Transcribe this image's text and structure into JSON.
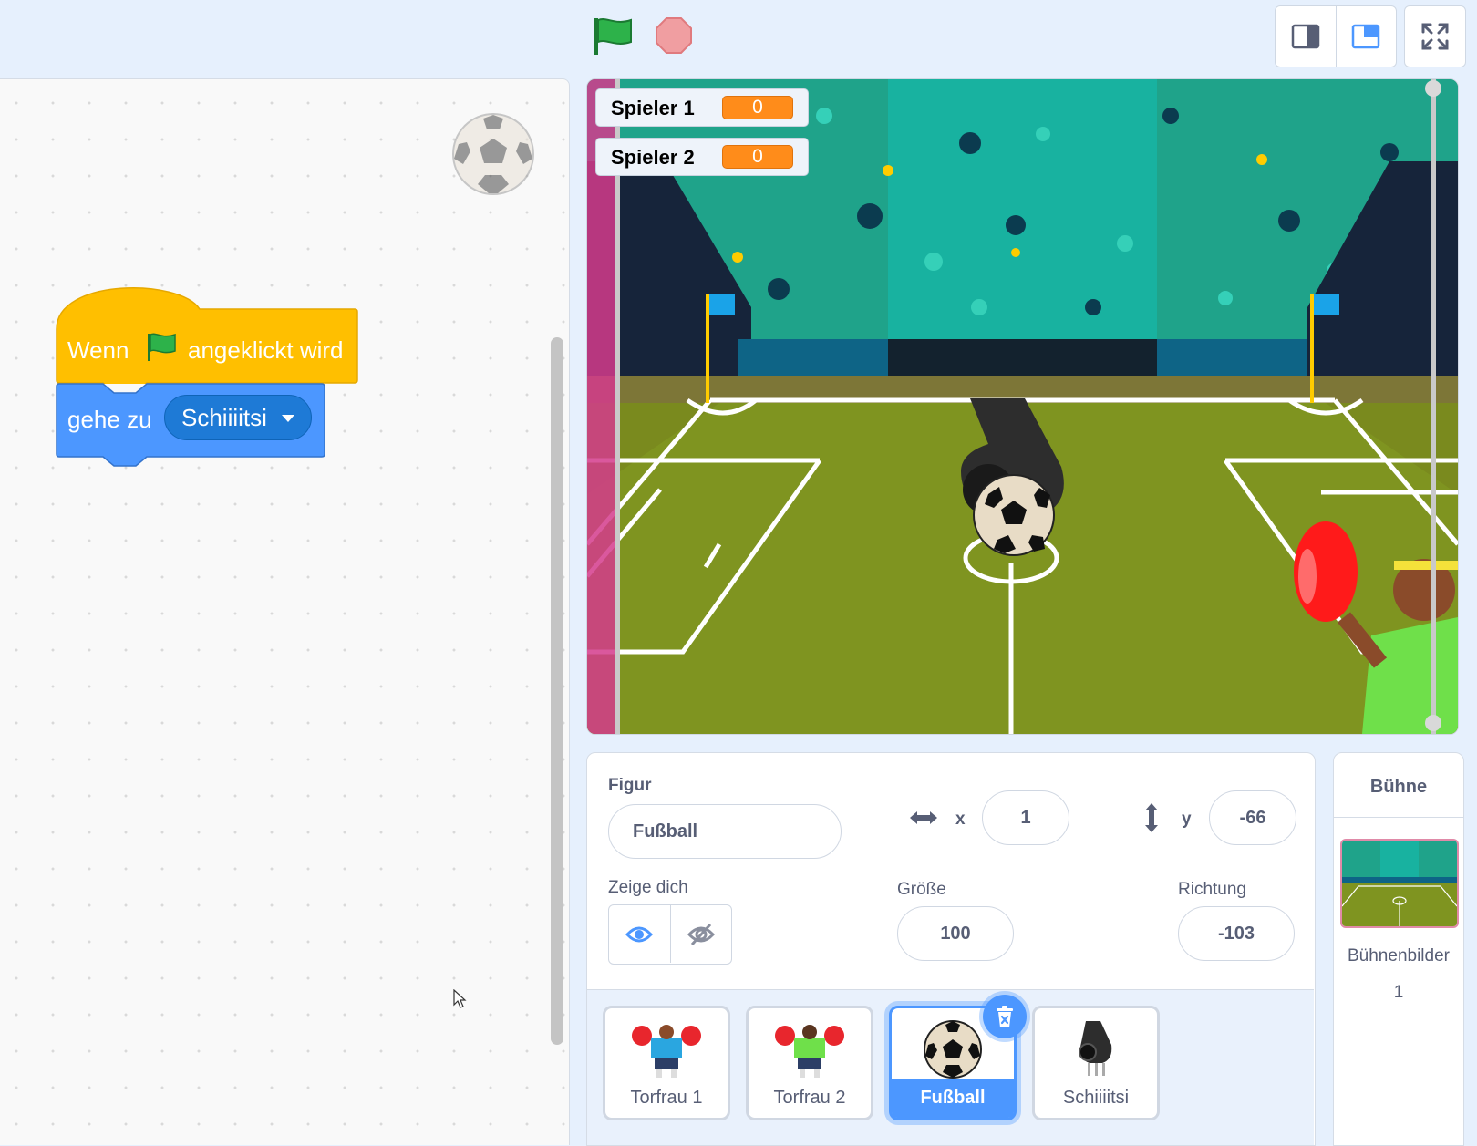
{
  "toolbar": {
    "green_flag_icon": "green-flag-icon",
    "stop_icon": "stop-sign-icon",
    "layout_small_icon": "small-stage-layout-icon",
    "layout_normal_icon": "normal-stage-layout-icon",
    "fullscreen_icon": "fullscreen-icon",
    "colors": {
      "flag": "#2db24a",
      "stop": "#f09ea1"
    }
  },
  "code": {
    "hat_block": {
      "before": "Wenn",
      "after": "angeklickt wird",
      "icon": "green-flag-icon",
      "color": "#ffbf00"
    },
    "motion_block": {
      "label": "gehe zu",
      "dropdown_value": "Schiiiitsi",
      "color": "#4c97ff"
    }
  },
  "stage": {
    "monitors": [
      {
        "label": "Spieler 1",
        "value": "0"
      },
      {
        "label": "Spieler 2",
        "value": "0"
      }
    ]
  },
  "sprite_info": {
    "sprite_label": "Figur",
    "sprite_name": "Fußball",
    "x_label": "x",
    "x_value": "1",
    "y_label": "y",
    "y_value": "-66",
    "show_label": "Zeige dich",
    "size_label": "Größe",
    "size_value": "100",
    "direction_label": "Richtung",
    "direction_value": "-103"
  },
  "sprites": [
    {
      "name": "Torfrau 1",
      "icon": "goalkeeper-blue-icon",
      "selected": false
    },
    {
      "name": "Torfrau 2",
      "icon": "goalkeeper-green-icon",
      "selected": false
    },
    {
      "name": "Fußball",
      "icon": "soccer-ball-icon",
      "selected": true
    },
    {
      "name": "Schiiiitsi",
      "icon": "whistle-icon",
      "selected": false
    }
  ],
  "stage_panel": {
    "title": "Bühne",
    "backdrops_label": "Bühnenbilder",
    "backdrops_count": "1"
  }
}
